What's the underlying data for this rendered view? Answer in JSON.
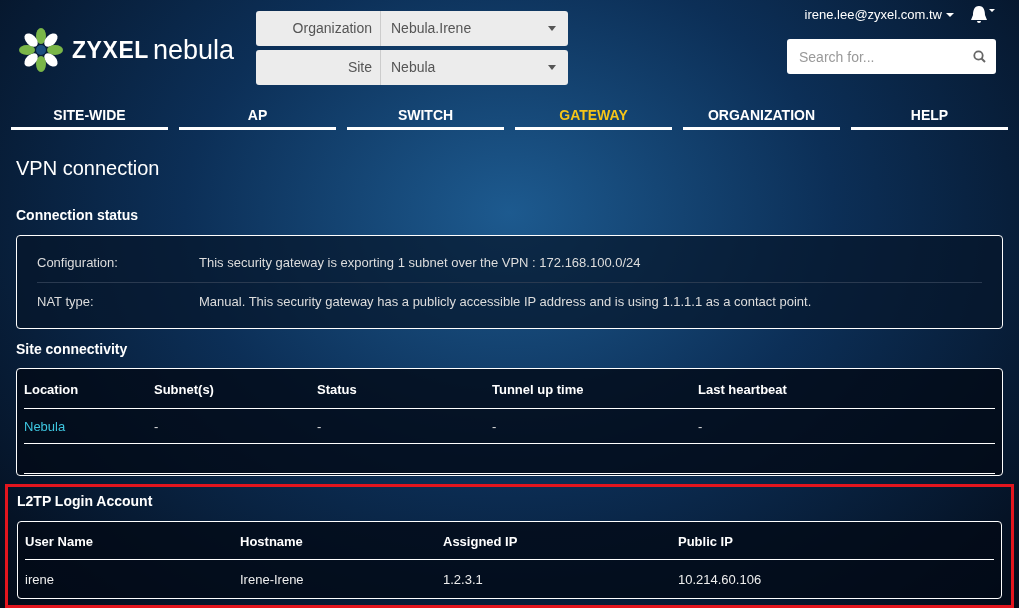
{
  "header": {
    "logo": {
      "brand": "ZYXEL",
      "product": "nebula"
    },
    "selectors": [
      {
        "label": "Organization",
        "value": "Nebula.Irene"
      },
      {
        "label": "Site",
        "value": "Nebula"
      }
    ],
    "user": "irene.lee@zyxel.com.tw",
    "search": {
      "placeholder": "Search for..."
    }
  },
  "nav": [
    {
      "label": "SITE-WIDE",
      "selected": false
    },
    {
      "label": "AP",
      "selected": false
    },
    {
      "label": "SWITCH",
      "selected": false
    },
    {
      "label": "GATEWAY",
      "selected": true
    },
    {
      "label": "ORGANIZATION",
      "selected": false
    },
    {
      "label": "HELP",
      "selected": false
    }
  ],
  "page_title": "VPN connection",
  "connection_status": {
    "title": "Connection status",
    "rows": [
      {
        "label": "Configuration:",
        "value": "This security gateway is exporting 1 subnet over the VPN : 172.168.100.0/24"
      },
      {
        "label": "NAT type:",
        "value": "Manual. This security gateway has a publicly accessible IP address and is using 1.1.1.1 as a contact point."
      }
    ]
  },
  "site_connectivity": {
    "title": "Site connectivity",
    "columns": [
      "Location",
      "Subnet(s)",
      "Status",
      "Tunnel up time",
      "Last heartbeat"
    ],
    "rows": [
      [
        "Nebula",
        "-",
        "-",
        "-",
        "-"
      ]
    ]
  },
  "l2tp": {
    "title": "L2TP Login Account",
    "highlighted": true,
    "columns": [
      "User Name",
      "Hostname",
      "Assigned IP",
      "Public IP"
    ],
    "rows": [
      [
        "irene",
        "Irene-Irene",
        "1.2.3.1",
        "10.214.60.106"
      ]
    ]
  }
}
